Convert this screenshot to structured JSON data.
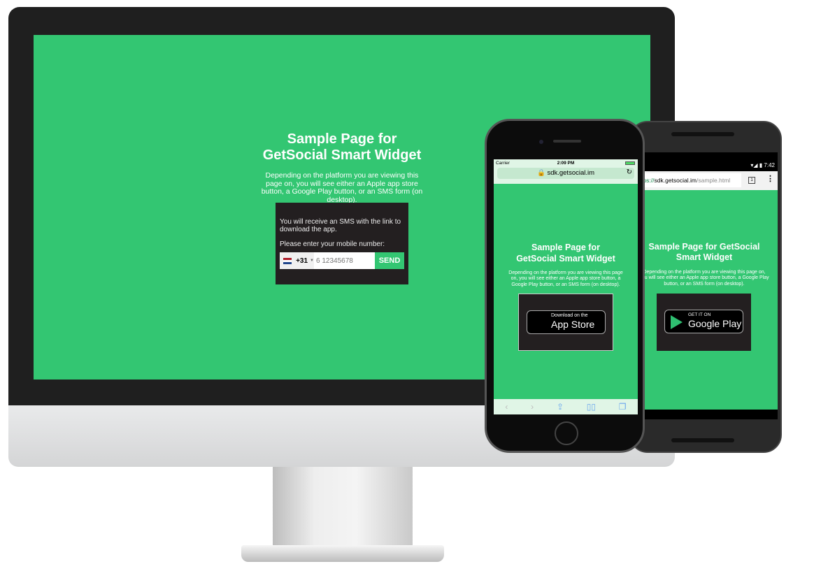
{
  "page": {
    "title_line1": "Sample Page for",
    "title_line2": "GetSocial Smart Widget",
    "title_android_line1": "Sample Page for GetSocial",
    "title_android_line2": "Smart Widget",
    "description": "Depending on the platform you are viewing this page on, you will see either an Apple app store button, a Google Play button, or an SMS form (on desktop)."
  },
  "desktop": {
    "sms_info": "You will receive an SMS with the link to download the app.",
    "prompt": "Please enter your mobile number:",
    "country_code": "+31",
    "phone_placeholder": "6 12345678",
    "send_label": "SEND"
  },
  "iphone": {
    "carrier": "Carrier",
    "time": "2:09 PM",
    "url": "sdk.getsocial.im",
    "badge_small": "Download on the",
    "badge_big": "App Store"
  },
  "android": {
    "time": "7:42",
    "url_scheme": "https://",
    "url_host": "sdk.getsocial.im",
    "url_path": "/sample.html",
    "tabs_count": "1",
    "badge_small": "GET IT ON",
    "badge_big": "Google Play"
  },
  "colors": {
    "green": "#33c672",
    "widget": "#231f20"
  }
}
